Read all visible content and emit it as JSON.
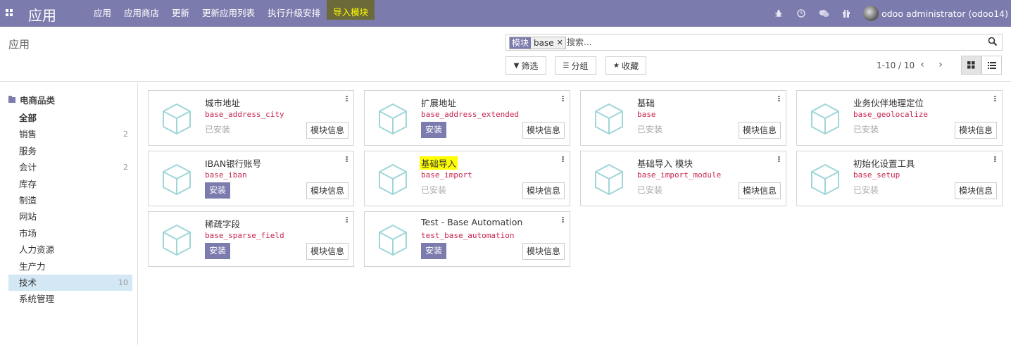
{
  "navbar": {
    "brand": "应用",
    "menu": [
      {
        "label": "应用"
      },
      {
        "label": "应用商店"
      },
      {
        "label": "更新"
      },
      {
        "label": "更新应用列表"
      },
      {
        "label": "执行升级安排"
      },
      {
        "label": "导入模块"
      }
    ],
    "user": "odoo administrator (odoo14)",
    "accent_color": "#7c7bad",
    "system_icons": [
      "bug-icon",
      "clock-icon",
      "chat-icon",
      "gift-icon"
    ]
  },
  "control": {
    "breadcrumb": "应用",
    "search": {
      "facet_label": "模块",
      "facet_value": "base",
      "placeholder": "搜索..."
    },
    "buttons": {
      "filter": "筛选",
      "group": "分组",
      "favorites": "收藏"
    },
    "pager": "1-10 / 10"
  },
  "sidebar": {
    "header": "电商品类",
    "categories": [
      {
        "label": "全部",
        "count": ""
      },
      {
        "label": "销售",
        "count": "2"
      },
      {
        "label": "服务",
        "count": ""
      },
      {
        "label": "会计",
        "count": "2"
      },
      {
        "label": "库存",
        "count": ""
      },
      {
        "label": "制造",
        "count": ""
      },
      {
        "label": "网站",
        "count": ""
      },
      {
        "label": "市场",
        "count": ""
      },
      {
        "label": "人力资源",
        "count": ""
      },
      {
        "label": "生产力",
        "count": ""
      },
      {
        "label": "技术",
        "count": "10"
      },
      {
        "label": "系统管理",
        "count": ""
      }
    ]
  },
  "modules": [
    {
      "title": "城市地址",
      "tech": "base_address_city",
      "status": "已安装",
      "info": "模块信息"
    },
    {
      "title": "扩展地址",
      "tech": "base_address_extended",
      "status": "安装",
      "info": "模块信息"
    },
    {
      "title": "基础",
      "tech": "base",
      "status": "已安装",
      "info": "模块信息"
    },
    {
      "title": "业务伙伴地理定位",
      "tech": "base_geolocalize",
      "status": "已安装",
      "info": "模块信息"
    },
    {
      "title": "IBAN银行账号",
      "tech": "base_iban",
      "status": "安装",
      "info": "模块信息"
    },
    {
      "title": "基础导入",
      "tech": "base_import",
      "status": "已安装",
      "info": "模块信息"
    },
    {
      "title": "基础导入 模块",
      "tech": "base_import_module",
      "status": "已安装",
      "info": "模块信息"
    },
    {
      "title": "初始化设置工具",
      "tech": "base_setup",
      "status": "已安装",
      "info": "模块信息"
    },
    {
      "title": "稀疏字段",
      "tech": "base_sparse_field",
      "status": "安装",
      "info": "模块信息"
    },
    {
      "title": "Test - Base Automation",
      "tech": "test_base_automation",
      "status": "安装",
      "info": "模块信息"
    }
  ]
}
